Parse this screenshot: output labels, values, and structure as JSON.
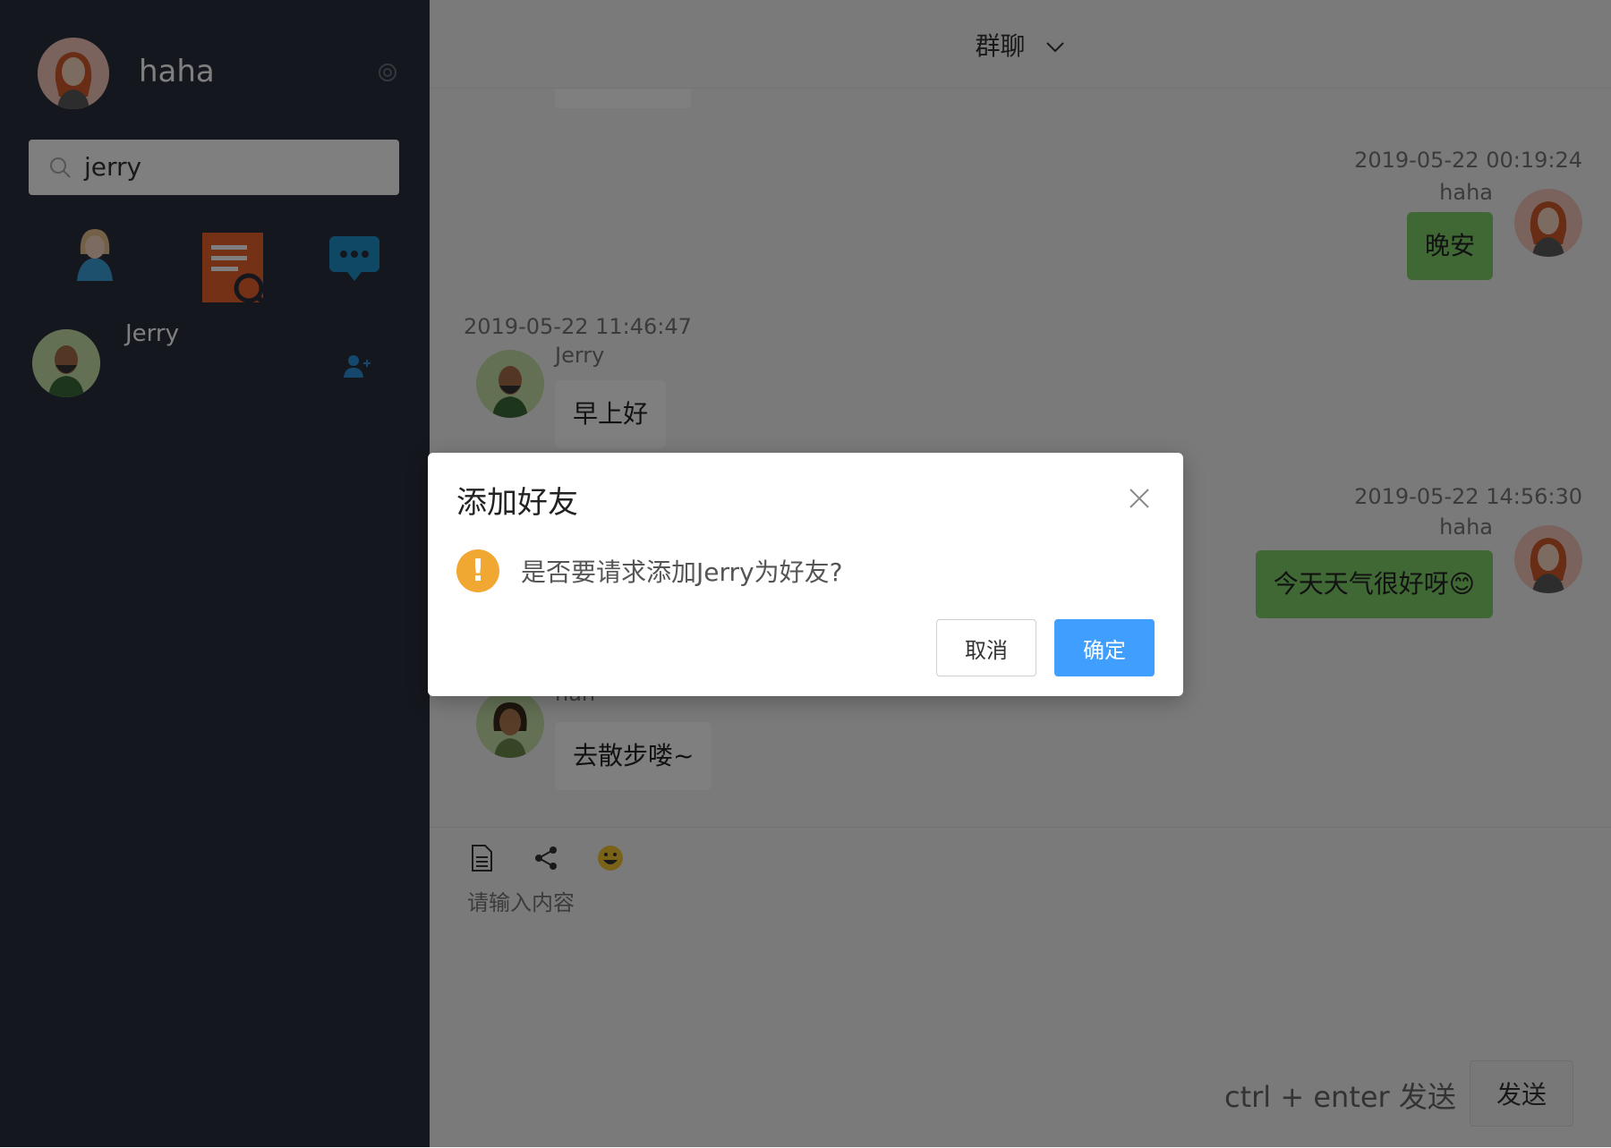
{
  "sidebar": {
    "me": {
      "name": "haha"
    },
    "search": {
      "value": "jerry",
      "placeholder": "jerry"
    },
    "friend_results": [
      {
        "name": "Jerry"
      }
    ]
  },
  "header": {
    "title": "群聊"
  },
  "messages": [
    {
      "time": "2019-05-22 00:19:24",
      "sender": "haha",
      "text": "晚安"
    },
    {
      "time": "2019-05-22 11:46:47",
      "sender": "Jerry",
      "text": "早上好"
    },
    {
      "time": "2019-05-22 14:56:30",
      "sender": "haha",
      "text": "今天天气很好呀😊"
    },
    {
      "sender": "han",
      "text": "去散步喽~"
    }
  ],
  "input": {
    "placeholder": "请输入内容",
    "hint": "ctrl + enter 发送",
    "send_label": "发送"
  },
  "dialog": {
    "title": "添加好友",
    "message": "是否要请求添加Jerry为好友?",
    "cancel_label": "取消",
    "ok_label": "确定"
  },
  "colors": {
    "sidebar_bg": "#2a2e3c",
    "my_bubble": "#7fd16a",
    "primary_button": "#409eff",
    "warning": "#f0a832",
    "search_result_icon": "#e8632a",
    "chat_icon": "#1e90c8"
  }
}
